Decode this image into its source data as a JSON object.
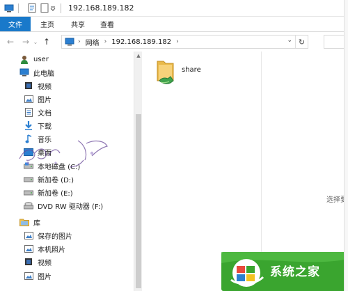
{
  "window": {
    "title": "192.168.189.182"
  },
  "ribbon": {
    "tabs": [
      {
        "label": "文件"
      },
      {
        "label": "主页"
      },
      {
        "label": "共享"
      },
      {
        "label": "查看"
      }
    ]
  },
  "address": {
    "breadcrumb": [
      "网络",
      "192.168.189.182"
    ]
  },
  "sidebar": {
    "items": [
      {
        "label": "user",
        "icon": "user-icon"
      },
      {
        "label": "此电脑",
        "icon": "computer-icon"
      },
      {
        "label": "视频",
        "icon": "video-icon"
      },
      {
        "label": "图片",
        "icon": "pictures-icon"
      },
      {
        "label": "文档",
        "icon": "documents-icon"
      },
      {
        "label": "下载",
        "icon": "download-icon"
      },
      {
        "label": "音乐",
        "icon": "music-icon"
      },
      {
        "label": "桌面",
        "icon": "desktop-icon"
      },
      {
        "label": "本地磁盘 (C:)",
        "icon": "drive-icon"
      },
      {
        "label": "新加卷 (D:)",
        "icon": "drive-icon"
      },
      {
        "label": "新加卷 (E:)",
        "icon": "drive-icon"
      },
      {
        "label": "DVD RW 驱动器 (F:)",
        "icon": "dvd-drive-icon"
      },
      {
        "label": "库",
        "icon": "library-icon"
      },
      {
        "label": "保存的图片",
        "icon": "pictures-icon"
      },
      {
        "label": "本机照片",
        "icon": "pictures-icon"
      },
      {
        "label": "视频",
        "icon": "video-icon"
      },
      {
        "label": "图片",
        "icon": "pictures-icon"
      }
    ]
  },
  "content": {
    "items": [
      {
        "label": "share",
        "icon": "shared-folder-icon"
      }
    ]
  },
  "preview": {
    "text": "选择要"
  },
  "branding": {
    "text": "系统之家"
  },
  "colors": {
    "accent": "#1979ca",
    "brand_green": "#3aa52f"
  }
}
